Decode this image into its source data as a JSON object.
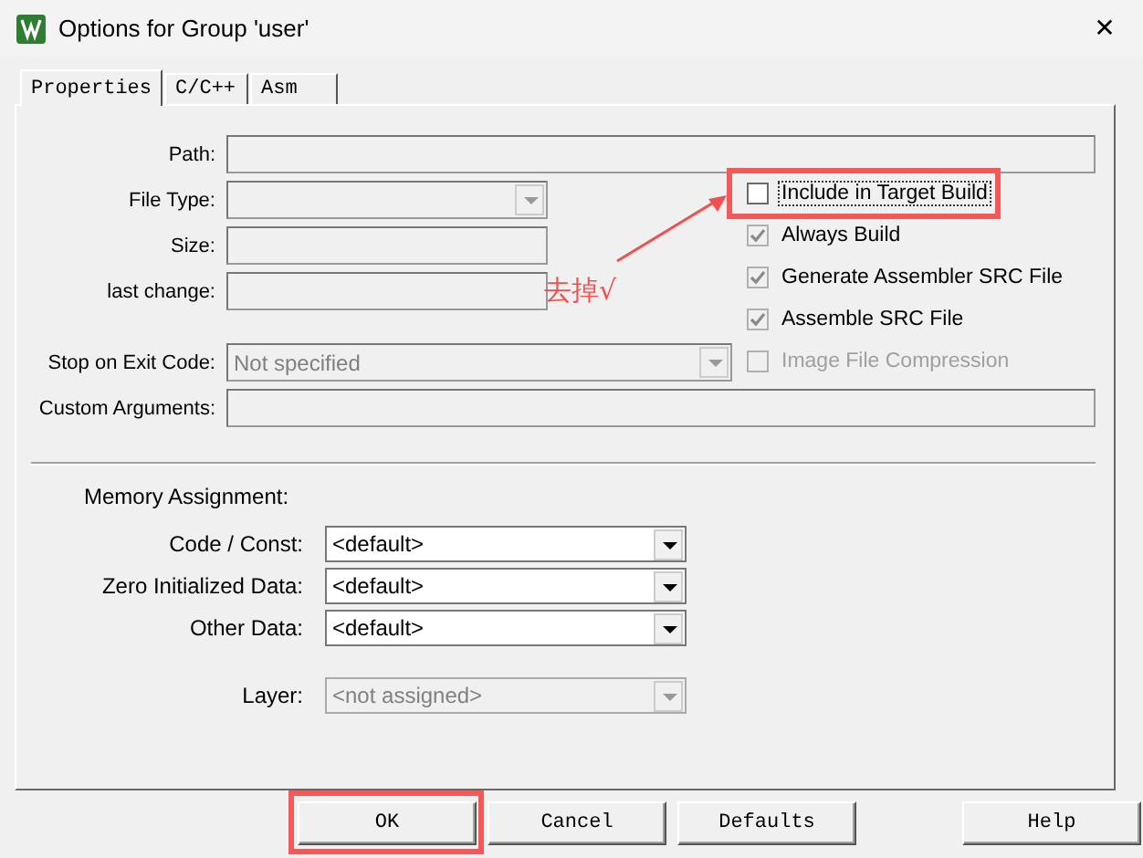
{
  "window": {
    "title": "Options for Group 'user'",
    "close": "✕"
  },
  "tabs": [
    {
      "label": "Properties",
      "selected": true
    },
    {
      "label": "C/C++",
      "selected": false
    },
    {
      "label": "Asm",
      "selected": false
    }
  ],
  "path": {
    "label": "Path:"
  },
  "file_type": {
    "label": "File Type:"
  },
  "size": {
    "label": "Size:"
  },
  "last_change": {
    "label": "last change:"
  },
  "stop_on_exit_code": {
    "label": "Stop on Exit Code:",
    "value": "Not specified"
  },
  "custom_arguments": {
    "label": "Custom Arguments:"
  },
  "options": [
    {
      "label": "Include in Target Build",
      "checked": false,
      "greyed": false,
      "disabled": false,
      "focused": true
    },
    {
      "label": "Always Build",
      "checked": true,
      "greyed": true,
      "disabled": false,
      "focused": false
    },
    {
      "label": "Generate Assembler SRC File",
      "checked": true,
      "greyed": true,
      "disabled": false,
      "focused": false
    },
    {
      "label": "Assemble SRC File",
      "checked": true,
      "greyed": true,
      "disabled": false,
      "focused": false
    },
    {
      "label": "Image File Compression",
      "checked": false,
      "greyed": true,
      "disabled": true,
      "focused": false
    }
  ],
  "memory": {
    "title": "Memory Assignment:",
    "rows": [
      {
        "label": "Code / Const:",
        "value": "<default>",
        "disabled": false
      },
      {
        "label": "Zero Initialized Data:",
        "value": "<default>",
        "disabled": false
      },
      {
        "label": "Other Data:",
        "value": "<default>",
        "disabled": false
      }
    ],
    "layer": {
      "label": "Layer:",
      "value": "<not assigned>",
      "disabled": true
    }
  },
  "annotation": {
    "text": "去掉√"
  },
  "buttons": [
    {
      "label": "OK"
    },
    {
      "label": "Cancel"
    },
    {
      "label": "Defaults"
    },
    {
      "label": "Help"
    }
  ]
}
